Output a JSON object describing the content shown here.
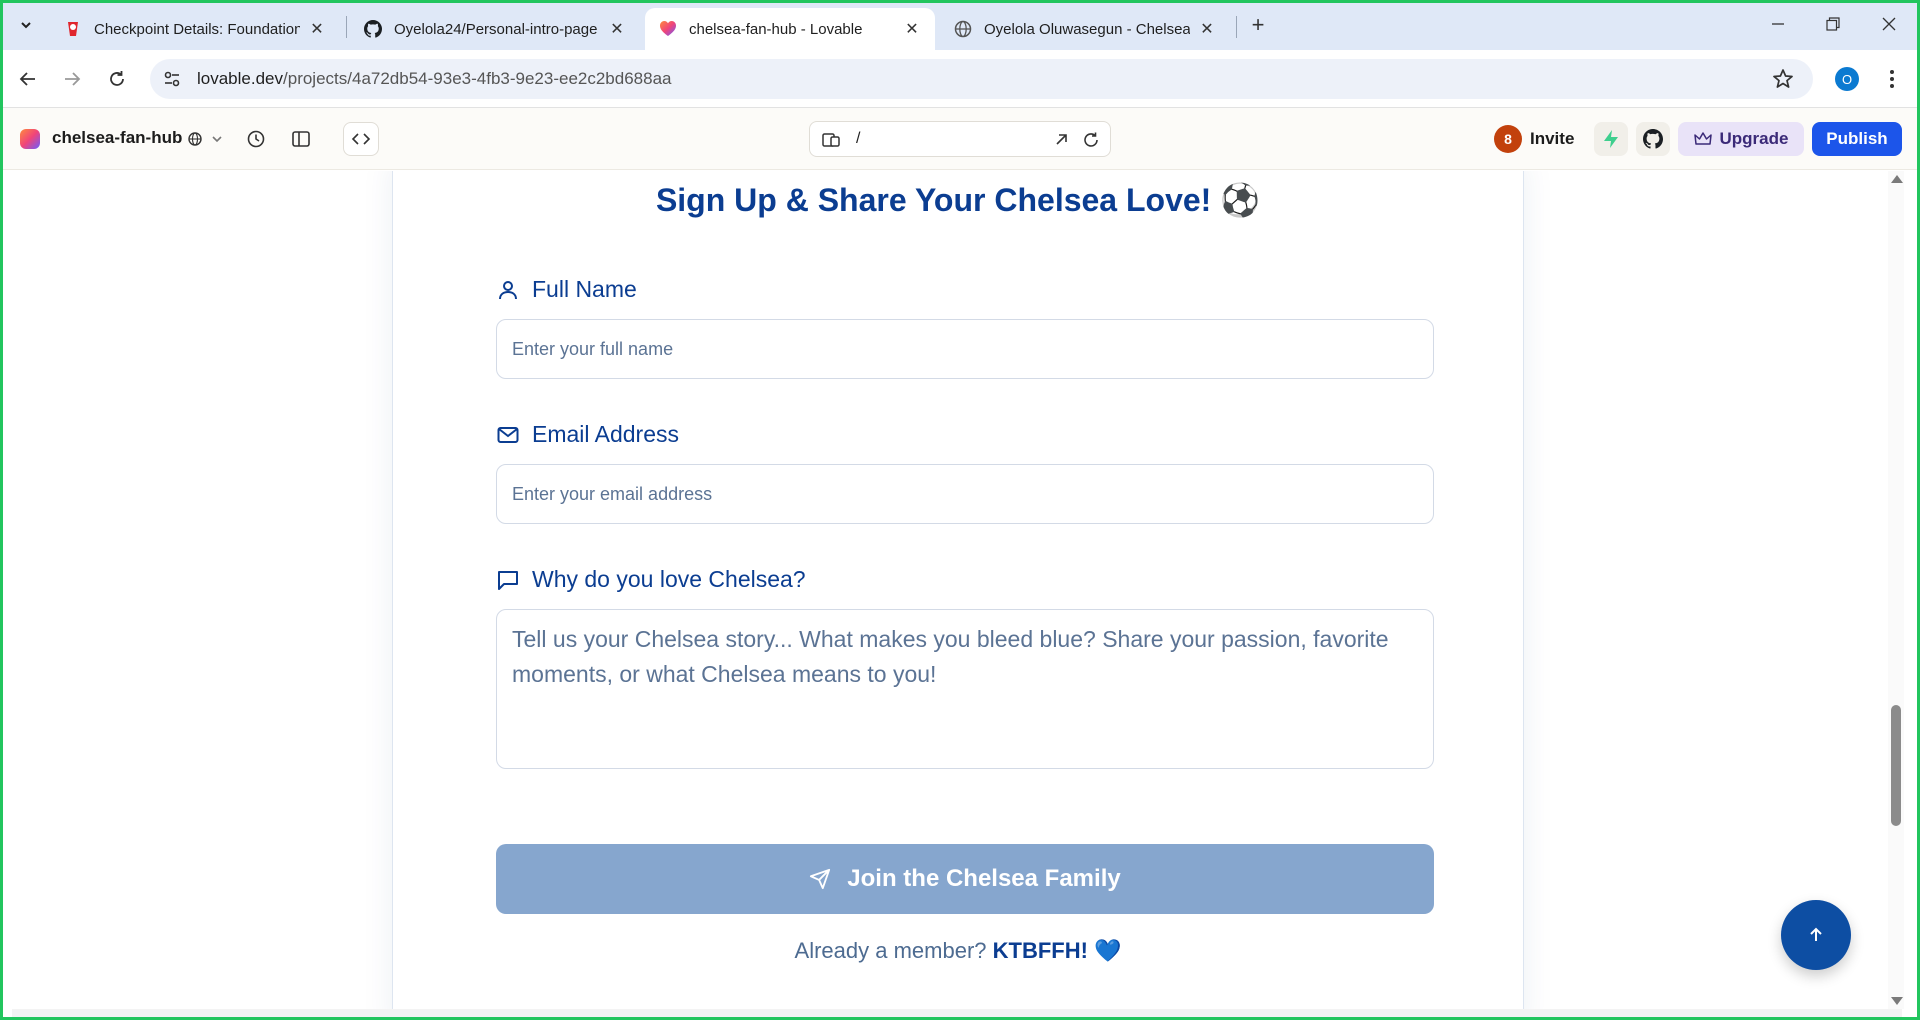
{
  "browser": {
    "tabs": [
      {
        "title": "Checkpoint Details: Foundation",
        "favicon": "checkpoint-icon",
        "active": false
      },
      {
        "title": "Oyelola24/Personal-intro-page",
        "favicon": "github-icon",
        "active": false
      },
      {
        "title": "chelsea-fan-hub - Lovable",
        "favicon": "lovable-icon",
        "active": true
      },
      {
        "title": "Oyelola Oluwasegun - Chelsea F",
        "favicon": "globe-icon",
        "active": false
      }
    ],
    "url_domain": "lovable.dev",
    "url_path": "/projects/4a72db54-93e3-4fb3-9e23-ee2c2bd688aa",
    "profile_initial": "O"
  },
  "lovable": {
    "project_name": "chelsea-fan-hub",
    "route_path": "/",
    "invite_badge": "8",
    "invite_label": "Invite",
    "upgrade_label": "Upgrade",
    "publish_label": "Publish"
  },
  "form": {
    "title": "Sign Up & Share Your Chelsea Love! ⚽",
    "full_name_label": "Full Name",
    "full_name_placeholder": "Enter your full name",
    "email_label": "Email Address",
    "email_placeholder": "Enter your email address",
    "why_label": "Why do you love Chelsea?",
    "why_placeholder": "Tell us your Chelsea story... What makes you bleed blue? Share your passion, favorite moments, or what Chelsea means to you!",
    "submit_label": "Join the Chelsea Family",
    "member_prefix": "Already a member?",
    "member_emphasis": "KTBFFH! 💙"
  },
  "colors": {
    "chelsea_blue": "#0b3d91",
    "submit_disabled": "#86a6ce",
    "publish_blue": "#1c55ea",
    "fab_blue": "#0d4ea3"
  }
}
